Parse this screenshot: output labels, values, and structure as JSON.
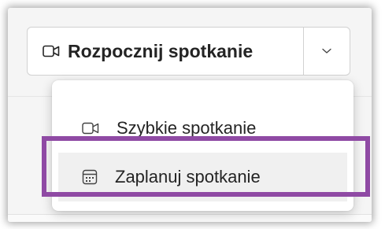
{
  "split_button": {
    "label": "Rozpocznij spotkanie",
    "main_icon": "video-camera-icon",
    "chevron_icon": "chevron-down-icon"
  },
  "menu": {
    "items": [
      {
        "label": "Szybkie spotkanie",
        "icon": "video-camera-icon",
        "highlighted": false
      },
      {
        "label": "Zaplanuj spotkanie",
        "icon": "calendar-icon",
        "highlighted": true
      }
    ]
  },
  "colors": {
    "highlight_border": "#8f4aa4",
    "text": "#242424",
    "hover_background": "#f0f0f0",
    "border": "#d1d1d1"
  }
}
